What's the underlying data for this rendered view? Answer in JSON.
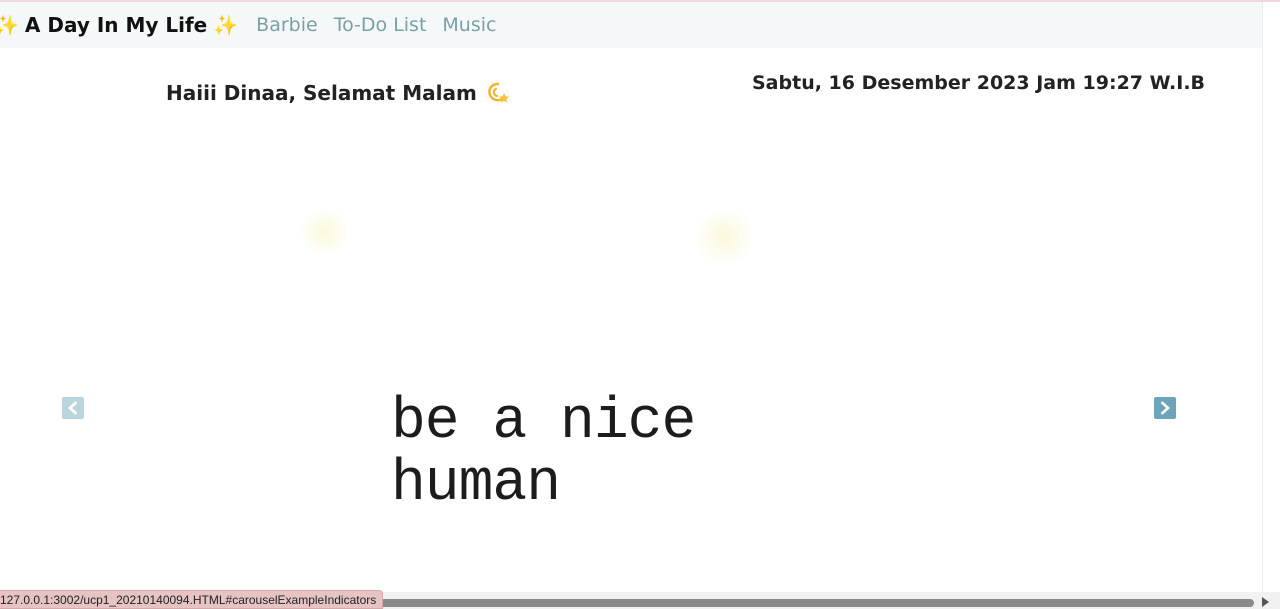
{
  "navbar": {
    "brand": "A Day In My Life",
    "brand_icon": "sparkles-icon",
    "links": [
      "Barbie",
      "To-Do List",
      "Music"
    ]
  },
  "greeting": {
    "text": "Haiii Dinaa, Selamat Malam",
    "icon": "dizzy-icon"
  },
  "datetime": "Sabtu, 16 Desember 2023 Jam 19:27 W.I.B",
  "carousel": {
    "quote": "be a nice\nhuman",
    "prev_icon": "chevron-left-icon",
    "next_icon": "chevron-right-icon"
  },
  "status_bar": {
    "url": "127.0.0.1:3002/ucp1_20210140094.HTML#carouselExampleIndicators"
  },
  "colors": {
    "navbar_bg": "#f5f8f8",
    "nav_link": "#7aa0a6",
    "sparkle": "#f5c242",
    "status_bg": "#e6c4c4"
  }
}
